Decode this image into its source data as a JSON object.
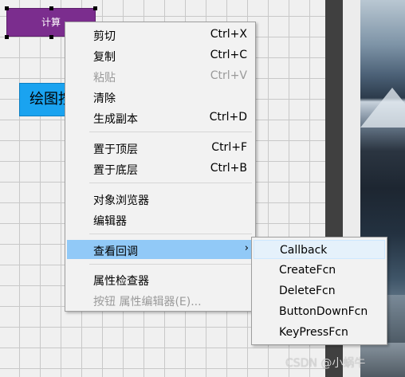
{
  "canvas": {
    "buttons": {
      "purple": {
        "label": "计算",
        "color": "#7b2d8e"
      },
      "blue": {
        "label": "绘图按",
        "color": "#1aa3f0"
      }
    }
  },
  "context_menu": {
    "items": [
      {
        "label": "剪切",
        "shortcut": "Ctrl+X",
        "enabled": true
      },
      {
        "label": "复制",
        "shortcut": "Ctrl+C",
        "enabled": true
      },
      {
        "label": "粘贴",
        "shortcut": "Ctrl+V",
        "enabled": false
      },
      {
        "label": "清除",
        "shortcut": "",
        "enabled": true
      },
      {
        "label": "生成副本",
        "shortcut": "Ctrl+D",
        "enabled": true
      },
      {
        "label": "置于顶层",
        "shortcut": "Ctrl+F",
        "enabled": true
      },
      {
        "label": "置于底层",
        "shortcut": "Ctrl+B",
        "enabled": true
      },
      {
        "label": "对象浏览器",
        "shortcut": "",
        "enabled": true
      },
      {
        "label": "编辑器",
        "shortcut": "",
        "enabled": true
      },
      {
        "label": "查看回调",
        "shortcut": "",
        "enabled": true,
        "submenu_arrow": "›"
      },
      {
        "label": "属性检查器",
        "shortcut": "",
        "enabled": true
      },
      {
        "label": "按钮 属性编辑器(E)...",
        "shortcut": "",
        "enabled": false
      }
    ],
    "highlight_color": "#91c9f7"
  },
  "submenu": {
    "items": [
      "Callback",
      "CreateFcn",
      "DeleteFcn",
      "ButtonDownFcn",
      "KeyPressFcn"
    ]
  },
  "watermark": "CSDN @小蜗牛"
}
